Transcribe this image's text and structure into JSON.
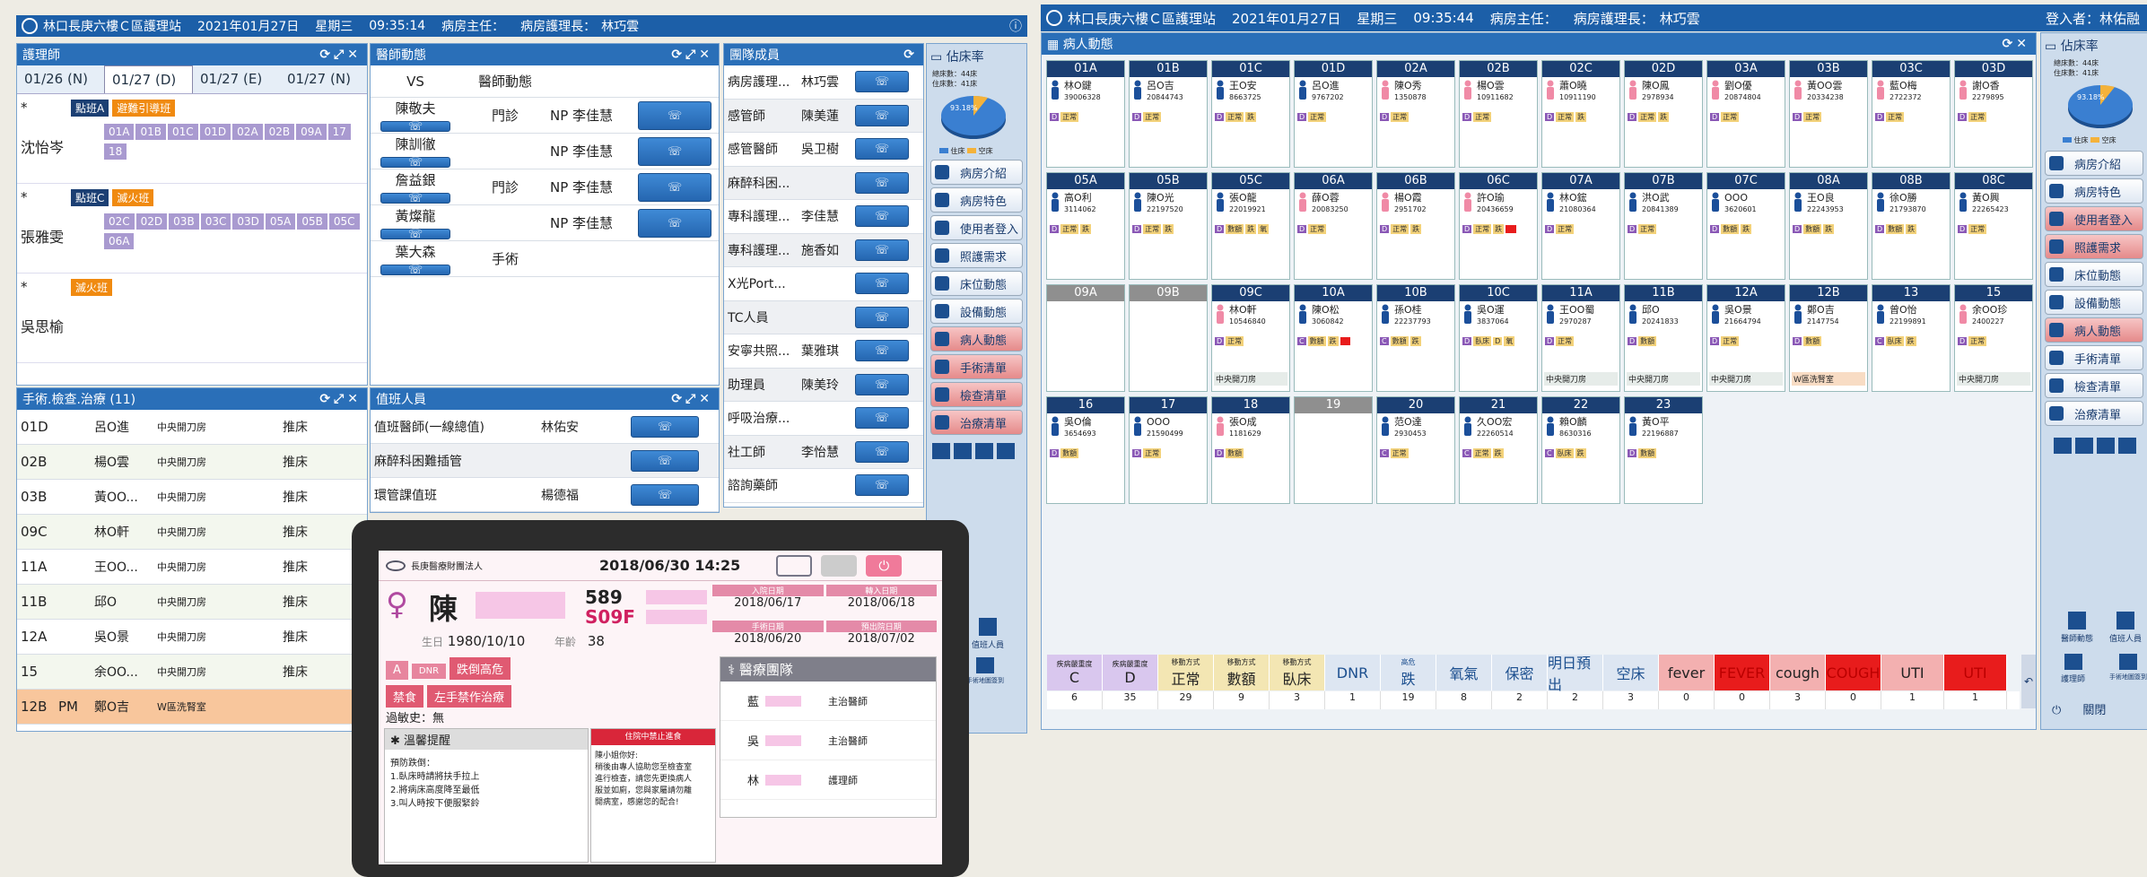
{
  "left_window": {
    "title": "林口長庚六樓Ｃ區護理站",
    "date": "2021年01月27日",
    "weekday": "星期三",
    "time": "09:35:14",
    "director_label": "病房主任：",
    "head_nurse_label": "病房護理長：",
    "head_nurse": "林巧雲"
  },
  "nurse_panel": {
    "title": "護理師",
    "tabs": [
      "01/26 (N)",
      "01/27 (D)",
      "01/27 (E)",
      "01/27 (N)"
    ],
    "groups": [
      {
        "mark": "*",
        "name": "沈怡岑",
        "tags": [
          {
            "label": "點班A",
            "color": "#1b3f73"
          },
          {
            "label": "避難引導班",
            "color": "#f08a10"
          }
        ],
        "beds": [
          "01A",
          "01B",
          "01C",
          "01D",
          "02A",
          "02B",
          "09A",
          "17",
          "18"
        ]
      },
      {
        "mark": "*",
        "name": "張雅雯",
        "tags": [
          {
            "label": "點班C",
            "color": "#1b3f73"
          },
          {
            "label": "滅火班",
            "color": "#f08a10"
          }
        ],
        "beds": [
          "02C",
          "02D",
          "03B",
          "03C",
          "03D",
          "05A",
          "05B",
          "05C",
          "06A"
        ]
      },
      {
        "mark": "*",
        "name": "吳思榆",
        "tags": [
          {
            "label": "滅火班",
            "color": "#f08a10"
          }
        ],
        "beds": []
      }
    ]
  },
  "doctor_panel": {
    "title": "醫師動態",
    "col_vs": "VS",
    "col_status": "醫師動態",
    "rows": [
      {
        "name": "陳敬夫",
        "status": "門診",
        "np": "NP 李佳慧"
      },
      {
        "name": "陳訓徹",
        "status": "",
        "np": "NP 李佳慧"
      },
      {
        "name": "詹益銀",
        "status": "門診",
        "np": "NP 李佳慧"
      },
      {
        "name": "黃燦龍",
        "status": "",
        "np": "NP 李佳慧"
      },
      {
        "name": "葉大森",
        "status": "手術",
        "np": ""
      }
    ]
  },
  "member_panel": {
    "title": "團隊成員",
    "rows": [
      {
        "role": "病房護理...",
        "name": "林巧雲"
      },
      {
        "role": "感管師",
        "name": "陳美蓮"
      },
      {
        "role": "感管醫師",
        "name": "吳卫樹"
      },
      {
        "role": "麻醉科困...",
        "name": ""
      },
      {
        "role": "專科護理...",
        "name": "李佳慧"
      },
      {
        "role": "專科護理...",
        "name": "施香如"
      },
      {
        "role": "X光Port...",
        "name": ""
      },
      {
        "role": "TC人員",
        "name": ""
      },
      {
        "role": "安寧共照...",
        "name": "葉雅琪"
      },
      {
        "role": "助理員",
        "name": "陳美玲"
      },
      {
        "role": "呼吸治療...",
        "name": ""
      },
      {
        "role": "社工師",
        "name": "李怡慧"
      },
      {
        "role": "諮詢藥師",
        "name": ""
      }
    ]
  },
  "occupancy": {
    "title": "佔床率",
    "line1": "總床數：44床",
    "line2": "住床數：41床",
    "percent": "93.18%",
    "legend_a": "住床",
    "legend_b": "空床"
  },
  "side_menu": [
    "病房介紹",
    "病房特色",
    "使用者登入",
    "照護需求",
    "床位動態",
    "設備動態",
    "病人動態",
    "手術清單",
    "檢查清單",
    "治療清單"
  ],
  "side_extra": {
    "call": "值班人員",
    "handover": "手術地圖簽到",
    "logout": "關閉",
    "medic": "醫師動態",
    "nurse_team": "護理師"
  },
  "surgery_panel": {
    "title": "手術.檢查.治療 (11)",
    "rows": [
      {
        "bed": "01D",
        "shift": "",
        "name": "呂O進",
        "place": "中央開刀房",
        "action": "推床"
      },
      {
        "bed": "02B",
        "shift": "",
        "name": "楊O雲",
        "place": "中央開刀房",
        "action": "推床"
      },
      {
        "bed": "03B",
        "shift": "",
        "name": "黃OO...",
        "place": "中央開刀房",
        "action": "推床"
      },
      {
        "bed": "09C",
        "shift": "",
        "name": "林O軒",
        "place": "中央開刀房",
        "action": "推床"
      },
      {
        "bed": "11A",
        "shift": "",
        "name": "王OO...",
        "place": "中央開刀房",
        "action": "推床"
      },
      {
        "bed": "11B",
        "shift": "",
        "name": "邱O",
        "place": "中央開刀房",
        "action": "推床"
      },
      {
        "bed": "12A",
        "shift": "",
        "name": "吳O景",
        "place": "中央開刀房",
        "action": "推床"
      },
      {
        "bed": "15",
        "shift": "",
        "name": "余OO...",
        "place": "中央開刀房",
        "action": "推床"
      },
      {
        "bed": "12B",
        "shift": "PM",
        "name": "鄭O吉",
        "place": "W區洗腎室",
        "action": ""
      }
    ]
  },
  "duty_panel": {
    "title": "值班人員",
    "rows": [
      {
        "role": "值班醫師(一線總值)",
        "name": "林佑安"
      },
      {
        "role": "麻醉科困難插管",
        "name": ""
      },
      {
        "role": "環管課值班",
        "name": "楊德福"
      }
    ]
  },
  "tablet": {
    "hospital": "長庚醫療財團法人",
    "datetime": "2018/06/30 14:25",
    "surname": "陳",
    "bed_a": "589",
    "bed_b": "S09F",
    "birth_label": "生日",
    "birth": "1980/10/10",
    "age_label": "年齡",
    "age": "38",
    "admit_label": "入院日期",
    "admit": "2018/06/17",
    "transfer_label": "轉入日期",
    "transfer": "2018/06/18",
    "op_label": "手術日期",
    "op": "2018/06/20",
    "discharge_label": "預出院日期",
    "discharge": "2018/07/02",
    "tags": [
      "A",
      "DNR",
      "跌倒高危",
      "禁食",
      "左手禁作治療"
    ],
    "allergy": "過敏史：無",
    "reminder_title": "溫馨提醒",
    "alert_chip": "住院中禁止進食",
    "care_notes": "預防跌倒：\n1.臥床時請將扶手拉上\n2.將病床高度降至最低\n3.叫人時按下便服緊鈴",
    "message": "陳小姐你好:\n稍後由專人協助您至檢查室\n進行檢查，請您先更換病人\n服並如廁，您與家屬請勿離\n開病室，感謝您的配合!",
    "team_title": "醫療團隊",
    "team": [
      {
        "name": "藍",
        "role": "主治醫師"
      },
      {
        "name": "吳",
        "role": "主治醫師"
      },
      {
        "name": "林",
        "role": "護理師"
      }
    ]
  },
  "right_window": {
    "title": "林口長庚六樓Ｃ區護理站",
    "date": "2021年01月27日",
    "weekday": "星期三",
    "time": "09:35:44",
    "director_label": "病房主任：",
    "head_nurse_label": "病房護理長：",
    "head_nurse": "林巧雲",
    "login": "登入者：林佑融"
  },
  "patient_panel": {
    "title": "病人動態",
    "rows": [
      [
        {
          "bed": "01A",
          "name": "林O鍵",
          "id": "39006328",
          "g": "m",
          "tags": [
            "D",
            "正常"
          ]
        },
        {
          "bed": "01B",
          "name": "呂O吉",
          "id": "20844743",
          "g": "m",
          "tags": [
            "D",
            "正常"
          ]
        },
        {
          "bed": "01C",
          "name": "王O安",
          "id": "8663725",
          "g": "m",
          "tags": [
            "D",
            "正常",
            "跌"
          ]
        },
        {
          "bed": "01D",
          "name": "呂O進",
          "id": "9767202",
          "g": "m",
          "tags": [
            "D",
            "正常"
          ]
        },
        {
          "bed": "02A",
          "name": "陳O秀",
          "id": "1350878",
          "g": "f",
          "tags": [
            "D",
            "正常"
          ]
        },
        {
          "bed": "02B",
          "name": "楊O雲",
          "id": "10911682",
          "g": "f",
          "tags": [
            "D",
            "正常"
          ]
        },
        {
          "bed": "02C",
          "name": "蕭O曉",
          "id": "10911190",
          "g": "f",
          "tags": [
            "D",
            "正常",
            "跌"
          ]
        },
        {
          "bed": "02D",
          "name": "陳O鳳",
          "id": "2978934",
          "g": "f",
          "tags": [
            "D",
            "正常",
            "跌"
          ]
        },
        {
          "bed": "03A",
          "name": "劉O優",
          "id": "20874804",
          "g": "f",
          "tags": [
            "D",
            "正常"
          ]
        },
        {
          "bed": "03B",
          "name": "黃OO雲",
          "id": "20334238",
          "g": "f",
          "tags": [
            "D",
            "正常"
          ]
        },
        {
          "bed": "03C",
          "name": "藍O梅",
          "id": "2722372",
          "g": "f",
          "tags": [
            "D",
            "正常"
          ]
        },
        {
          "bed": "03D",
          "name": "謝O香",
          "id": "2279895",
          "g": "f",
          "tags": [
            "D",
            "正常"
          ]
        }
      ],
      [
        {
          "bed": "05A",
          "name": "高O利",
          "id": "3114062",
          "g": "m",
          "tags": [
            "D",
            "正常",
            "跌"
          ]
        },
        {
          "bed": "05B",
          "name": "陳O光",
          "id": "22197520",
          "g": "m",
          "tags": [
            "D",
            "正常",
            "跌"
          ]
        },
        {
          "bed": "05C",
          "name": "張O龍",
          "id": "22019921",
          "g": "m",
          "tags": [
            "D",
            "數額",
            "跌",
            "氧"
          ]
        },
        {
          "bed": "06A",
          "name": "薛O蓉",
          "id": "20083250",
          "g": "f",
          "tags": [
            "D",
            "正常"
          ]
        },
        {
          "bed": "06B",
          "name": "楊O霞",
          "id": "2951702",
          "g": "f",
          "tags": [
            "D",
            "正常",
            "跌"
          ]
        },
        {
          "bed": "06C",
          "name": "許O瑜",
          "id": "20436659",
          "g": "f",
          "tags": [
            "D",
            "正常",
            "跌",
            "■"
          ]
        },
        {
          "bed": "07A",
          "name": "林O鋐",
          "id": "21080364",
          "g": "m",
          "tags": [
            "D",
            "正常"
          ]
        },
        {
          "bed": "07B",
          "name": "洪O武",
          "id": "20841389",
          "g": "m",
          "tags": [
            "D",
            "正常"
          ]
        },
        {
          "bed": "07C",
          "name": "OOO",
          "id": "3620601",
          "g": "m",
          "tags": [
            "D",
            "數額",
            "跌"
          ]
        },
        {
          "bed": "08A",
          "name": "王O良",
          "id": "22243953",
          "g": "m",
          "tags": [
            "D",
            "數額",
            "跌"
          ]
        },
        {
          "bed": "08B",
          "name": "徐O勝",
          "id": "21793870",
          "g": "m",
          "tags": [
            "D",
            "數額",
            "跌"
          ]
        },
        {
          "bed": "08C",
          "name": "黃O興",
          "id": "22265423",
          "g": "m",
          "tags": [
            "D",
            "正常"
          ]
        }
      ],
      [
        {
          "bed": "09A",
          "name": "",
          "id": "",
          "g": "",
          "tags": [],
          "empty": true
        },
        {
          "bed": "09B",
          "name": "",
          "id": "",
          "g": "",
          "tags": [],
          "empty": true
        },
        {
          "bed": "09C",
          "name": "林O軒",
          "id": "10546840",
          "g": "f",
          "tags": [
            "D",
            "正常"
          ],
          "loc": "中央開刀房"
        },
        {
          "bed": "10A",
          "name": "陳O松",
          "id": "3060842",
          "g": "m",
          "tags": [
            "C",
            "數額",
            "跌",
            "■"
          ]
        },
        {
          "bed": "10B",
          "name": "孫O桂",
          "id": "22237793",
          "g": "m",
          "tags": [
            "C",
            "數額",
            "跌"
          ]
        },
        {
          "bed": "10C",
          "name": "吳O運",
          "id": "3837064",
          "g": "m",
          "tags": [
            "D",
            "臥床",
            "D",
            "氧"
          ]
        },
        {
          "bed": "11A",
          "name": "王OO蜀",
          "id": "2970287",
          "g": "m",
          "tags": [
            "D",
            "正常"
          ],
          "loc": "中央開刀房"
        },
        {
          "bed": "11B",
          "name": "邱O",
          "id": "20241833",
          "g": "m",
          "tags": [
            "D",
            "數額"
          ],
          "loc": "中央開刀房"
        },
        {
          "bed": "12A",
          "name": "吳O景",
          "id": "21664794",
          "g": "m",
          "tags": [
            "D",
            "正常"
          ],
          "loc": "中央開刀房"
        },
        {
          "bed": "12B",
          "name": "鄭O吉",
          "id": "2147754",
          "g": "m",
          "tags": [
            "D",
            "數額"
          ],
          "loc": "W區洗腎室",
          "peach": true
        },
        {
          "bed": "13",
          "name": "曾O怡",
          "id": "22199891",
          "g": "m",
          "tags": [
            "C",
            "臥床",
            "跌"
          ]
        },
        {
          "bed": "15",
          "name": "余OO珍",
          "id": "2400227",
          "g": "f",
          "tags": [
            "D",
            "正常"
          ],
          "loc": "中央開刀房"
        }
      ],
      [
        {
          "bed": "16",
          "name": "吳O倫",
          "id": "3654693",
          "g": "m",
          "tags": [
            "D",
            "數額"
          ]
        },
        {
          "bed": "17",
          "name": "OOO",
          "id": "21590499",
          "g": "m",
          "tags": [
            "D",
            "正常"
          ]
        },
        {
          "bed": "18",
          "name": "張O成",
          "id": "1181629",
          "g": "f",
          "tags": [
            "D",
            "數額"
          ]
        },
        {
          "bed": "19",
          "name": "",
          "id": "",
          "g": "",
          "tags": [],
          "empty": true
        },
        {
          "bed": "20",
          "name": "范O達",
          "id": "2930453",
          "g": "m",
          "tags": [
            "C",
            "正常"
          ]
        },
        {
          "bed": "21",
          "name": "久OO宏",
          "id": "22260514",
          "g": "m",
          "tags": [
            "C",
            "正常",
            "跌"
          ]
        },
        {
          "bed": "22",
          "name": "賴O麟",
          "id": "8630316",
          "g": "m",
          "tags": [
            "C",
            "臥床",
            "跌"
          ]
        },
        {
          "bed": "23",
          "name": "黃O平",
          "id": "22196887",
          "g": "m",
          "tags": [
            "D",
            "數額"
          ]
        }
      ]
    ]
  },
  "stats": [
    {
      "top": "疾病嚴重度",
      "label": "C",
      "value": "6",
      "bg": "#d9c7ee",
      "color": "#222"
    },
    {
      "top": "疾病嚴重度",
      "label": "D",
      "value": "35",
      "bg": "#d9c7ee",
      "color": "#222"
    },
    {
      "top": "移動方式",
      "label": "正常",
      "value": "29",
      "bg": "#f3e6b3",
      "color": "#222"
    },
    {
      "top": "移動方式",
      "label": "數額",
      "value": "9",
      "bg": "#f3e6b3",
      "color": "#222"
    },
    {
      "top": "移動方式",
      "label": "臥床",
      "value": "3",
      "bg": "#f3e6b3",
      "color": "#222"
    },
    {
      "top": "",
      "label": "DNR",
      "value": "1",
      "bg": "#dde6f2",
      "color": "#1c4f8f"
    },
    {
      "top": "高危",
      "label": "跌",
      "value": "19",
      "bg": "#dde6f2",
      "color": "#1c4f8f"
    },
    {
      "top": "",
      "label": "氧氣",
      "value": "8",
      "bg": "#dde6f2",
      "color": "#1c4f8f"
    },
    {
      "top": "",
      "label": "保密",
      "value": "2",
      "bg": "#dde6f2",
      "color": "#1c4f8f"
    },
    {
      "top": "",
      "label": "明日預出",
      "value": "2",
      "bg": "#dde6f2",
      "color": "#1c4f8f"
    },
    {
      "top": "",
      "label": "空床",
      "value": "3",
      "bg": "#dde6f2",
      "color": "#1c4f8f"
    },
    {
      "top": "",
      "label": "fever",
      "value": "0",
      "bg": "#f3b0b0",
      "color": "#222"
    },
    {
      "top": "",
      "label": "FEVER",
      "value": "0",
      "bg": "#e81c1c",
      "color": "#b00"
    },
    {
      "top": "",
      "label": "cough",
      "value": "3",
      "bg": "#f3b0b0",
      "color": "#222"
    },
    {
      "top": "",
      "label": "COUGH",
      "value": "0",
      "bg": "#e81c1c",
      "color": "#b00"
    },
    {
      "top": "",
      "label": "UTI",
      "value": "1",
      "bg": "#f3b0b0",
      "color": "#222"
    },
    {
      "top": "",
      "label": "UTI",
      "value": "1",
      "bg": "#e81c1c",
      "color": "#b00"
    }
  ]
}
